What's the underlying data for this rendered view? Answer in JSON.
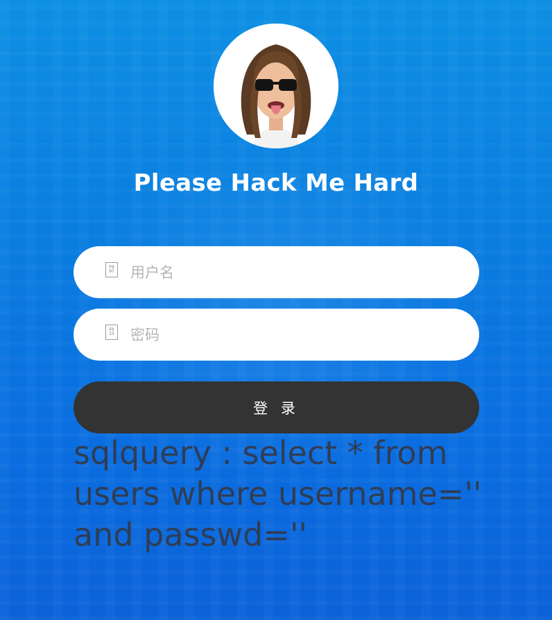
{
  "page": {
    "title": "Please Hack Me Hard"
  },
  "avatar": {
    "alt": "avatar"
  },
  "form": {
    "username": {
      "placeholder": "用户名",
      "value": "",
      "icon": "user-icon"
    },
    "password": {
      "placeholder": "密码",
      "value": "",
      "icon": "lock-icon"
    },
    "login_label": "登 录"
  },
  "sqlquery": {
    "text": "sqlquery : select * from users where username='' and passwd=''"
  },
  "colors": {
    "background_top": "#0d8fe3",
    "background_bottom": "#0b62d8",
    "button": "#333333",
    "title": "#ffffff",
    "sql_text": "#2f3d55"
  }
}
